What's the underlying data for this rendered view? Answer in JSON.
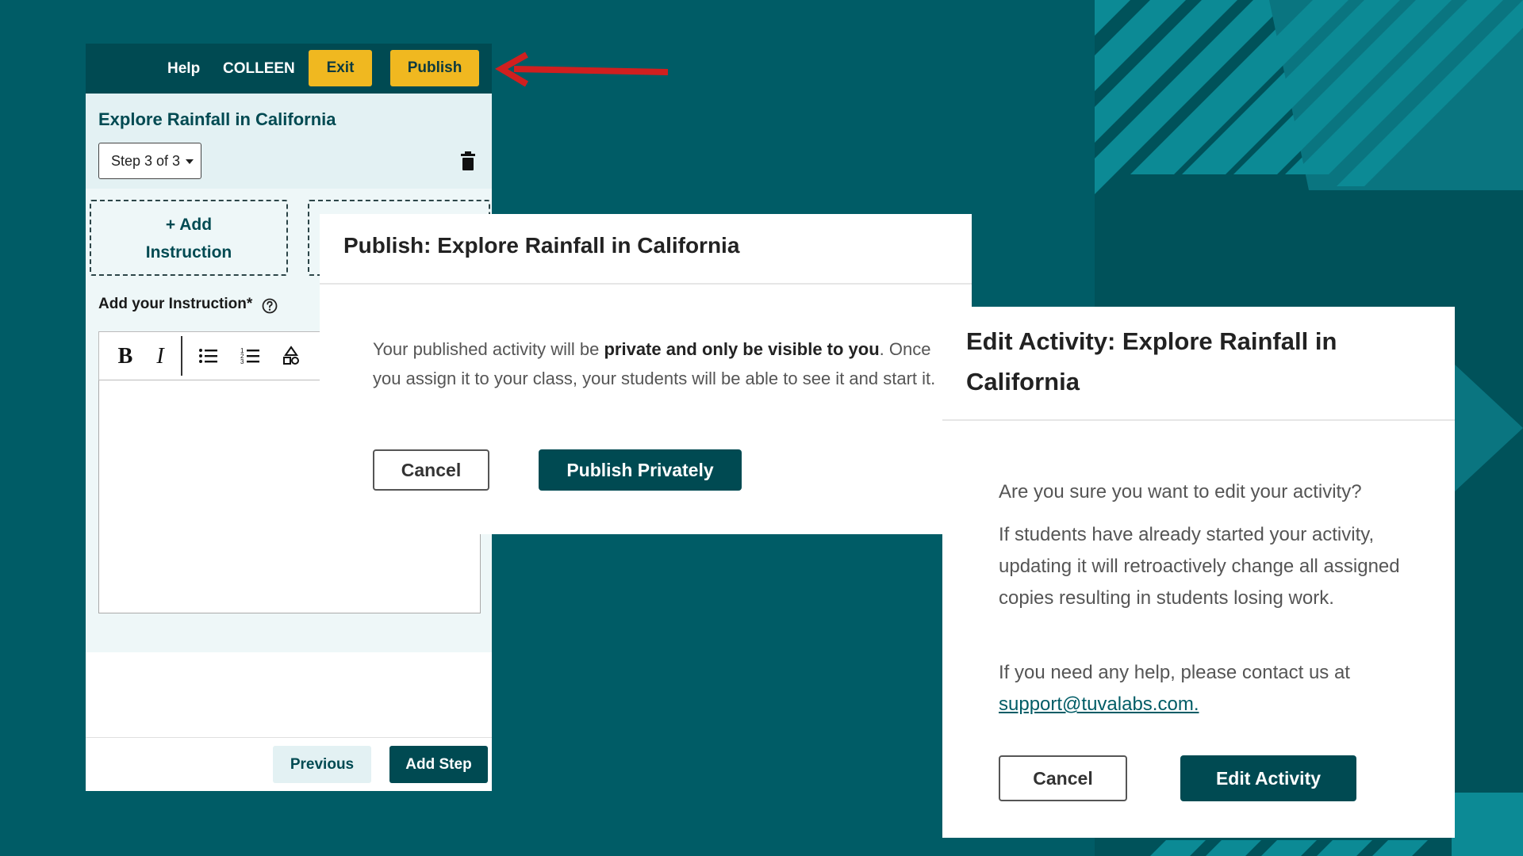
{
  "colors": {
    "background": "#005c66",
    "primary_dark": "#004a52",
    "accent_yellow": "#f0b820",
    "panel_tint": "#e3f1f3",
    "arrow_red": "#d01f1f"
  },
  "editor": {
    "topbar": {
      "help_label": "Help",
      "user_label": "COLLEEN",
      "exit_label": "Exit",
      "publish_label": "Publish"
    },
    "activity_title": "Explore Rainfall in California",
    "step_select": {
      "value": "Step 3 of 3"
    },
    "add_instruction": {
      "line1": "+ Add",
      "line2": "Instruction"
    },
    "instruction_label": "Add your Instruction*",
    "toolbar": {
      "bold_icon": "bold-icon",
      "italic_icon": "italic-icon",
      "bullet_list_icon": "bullet-list-icon",
      "numbered_list_icon": "numbered-list-icon",
      "shapes_icon": "shapes-icon"
    },
    "footer": {
      "previous_label": "Previous",
      "add_step_label": "Add Step"
    }
  },
  "publish_dialog": {
    "title": "Publish: Explore Rainfall in California",
    "text_before": "Your published activity will be ",
    "text_bold": "private and only be visible to you",
    "text_after": ". Once you assign it to your class, your students will be able to see it and start it.",
    "cancel_label": "Cancel",
    "confirm_label": "Publish Privately"
  },
  "edit_dialog": {
    "title": "Edit Activity: Explore Rainfall in California",
    "question": "Are you sure you want to edit your activity?",
    "warning": "If students have already started your activity, updating it will retroactively change all assigned copies resulting in students losing work.",
    "help_text": "If you need any help, please contact us at",
    "support_link": "support@tuvalabs.com.",
    "cancel_label": "Cancel",
    "confirm_label": "Edit Activity"
  }
}
